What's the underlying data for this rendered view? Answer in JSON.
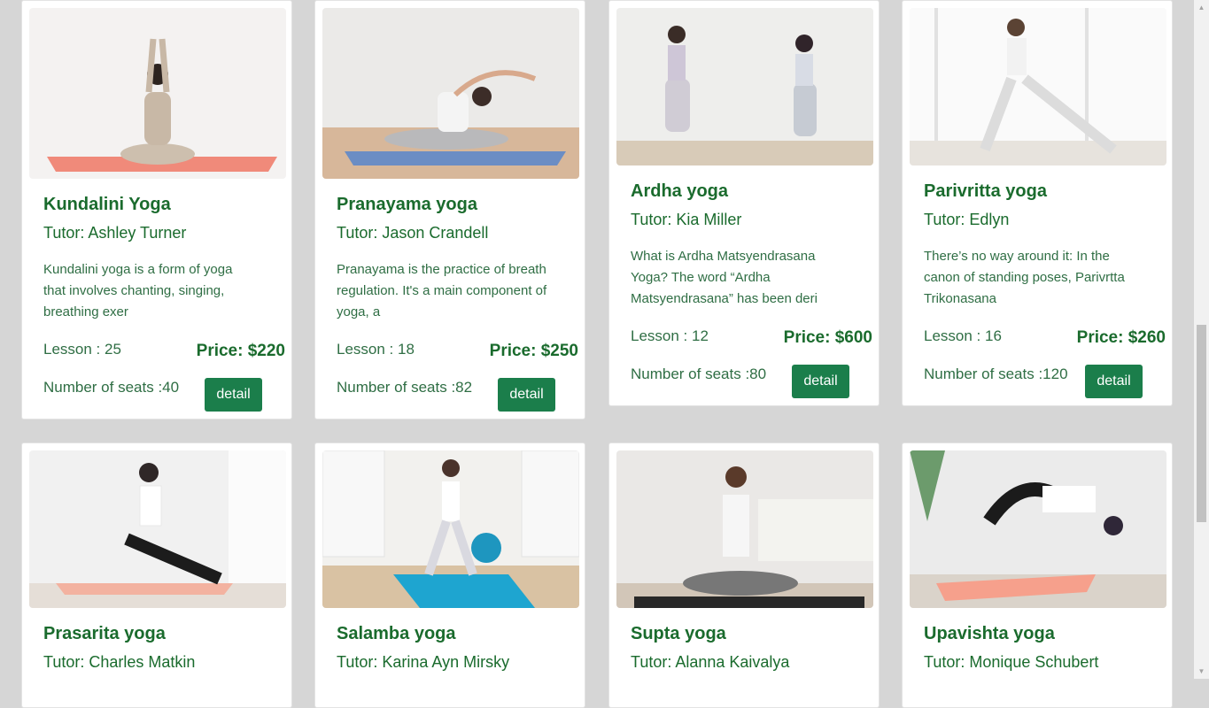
{
  "detail_label": "detail",
  "cards": [
    {
      "title": "Kundalini Yoga",
      "tutor": "Tutor: Ashley Turner",
      "desc": "Kundalini yoga is a form of yoga that involves chanting, singing, breathing exer",
      "lesson": "Lesson : 25",
      "price": "Price: $220",
      "seats": "Number of seats :40"
    },
    {
      "title": "Pranayama yoga",
      "tutor": "Tutor: Jason Crandell",
      "desc": "Pranayama is the practice of breath regulation. It's a main component of yoga, a",
      "lesson": "Lesson : 18",
      "price": "Price: $250",
      "seats": "Number of seats :82"
    },
    {
      "title": "Ardha yoga",
      "tutor": "Tutor: Kia Miller",
      "desc": "What is Ardha Matsyendrasana Yoga? The word “Ardha Matsyendrasana” has been deri",
      "lesson": "Lesson : 12",
      "price": "Price: $600",
      "seats": "Number of seats :80"
    },
    {
      "title": "Parivritta yoga",
      "tutor": "Tutor: Edlyn",
      "desc": "There’s no way around it: In the canon of standing poses, Parivrtta Trikonasana",
      "lesson": "Lesson : 16",
      "price": "Price: $260",
      "seats": "Number of seats :120"
    },
    {
      "title": "Prasarita yoga",
      "tutor": "Tutor: Charles Matkin"
    },
    {
      "title": "Salamba yoga",
      "tutor": "Tutor: Karina Ayn Mirsky"
    },
    {
      "title": "Supta yoga",
      "tutor": "Tutor: Alanna Kaivalya"
    },
    {
      "title": "Upavishta yoga",
      "tutor": "Tutor: Monique Schubert"
    }
  ],
  "colors": {
    "page_bg": "#d6d6d6",
    "title_green": "#1a6b2d",
    "button_green": "#1b7e4b"
  }
}
